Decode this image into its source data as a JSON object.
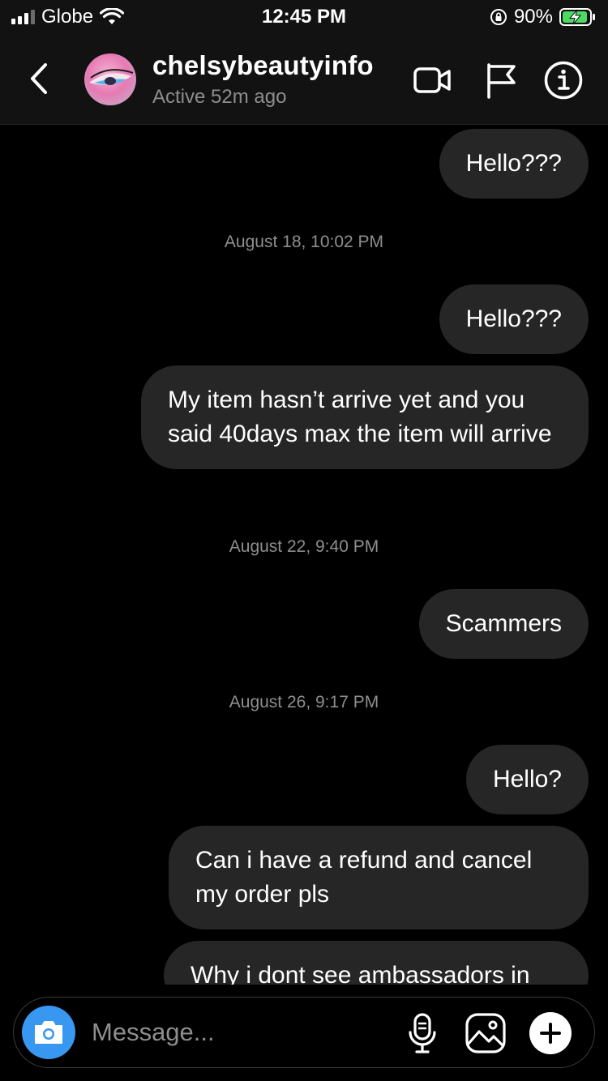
{
  "status_bar": {
    "carrier": "Globe",
    "time": "12:45 PM",
    "battery": "90%"
  },
  "header": {
    "username": "chelsybeautyinfo",
    "active_status": "Active 52m ago"
  },
  "messages": [
    {
      "type": "sent",
      "text": "Hello???"
    },
    {
      "type": "timestamp",
      "text": "August 18, 10:02 PM"
    },
    {
      "type": "sent",
      "text": "Hello???"
    },
    {
      "type": "sent",
      "text": "My item hasn’t arrive yet and you said 40days max the item will arrive"
    },
    {
      "type": "timestamp",
      "text": "August 22, 9:40 PM"
    },
    {
      "type": "sent",
      "text": "Scammers"
    },
    {
      "type": "timestamp",
      "text": "August 26, 9:17 PM"
    },
    {
      "type": "sent",
      "text": "Hello?"
    },
    {
      "type": "sent",
      "text": "Can i have a refund and cancel my order pls"
    },
    {
      "type": "sent",
      "text": "Why i dont see ambassadors in"
    }
  ],
  "composer": {
    "placeholder": "Message..."
  },
  "icons": {
    "back": "chevron-left-icon",
    "video": "video-camera-icon",
    "flag": "flag-icon",
    "info": "info-icon",
    "camera": "camera-icon",
    "mic": "microphone-icon",
    "gallery": "gallery-icon",
    "add": "plus-icon"
  },
  "colors": {
    "background": "#000000",
    "bubble": "#262626",
    "accent": "#3897f0",
    "muted_text": "#8e8e8e",
    "battery_green": "#4cd964"
  }
}
